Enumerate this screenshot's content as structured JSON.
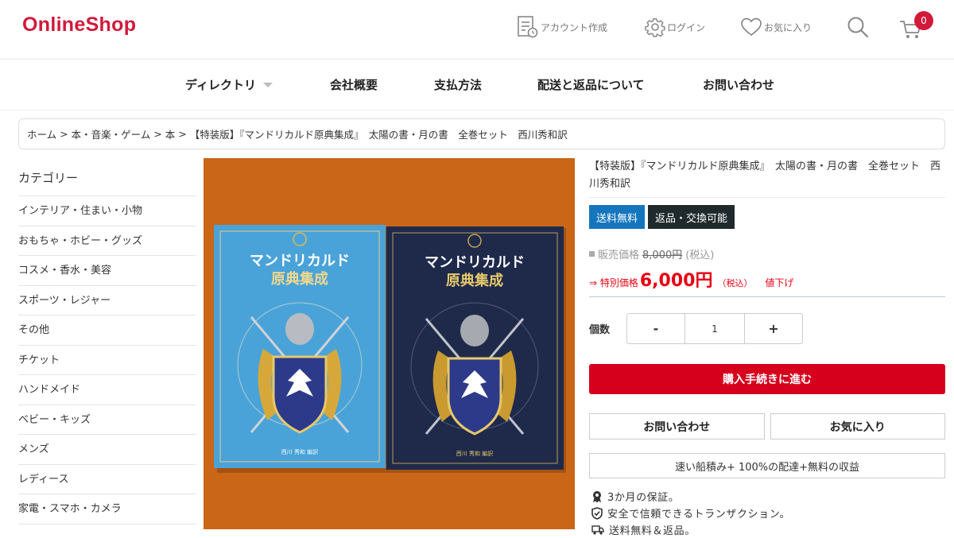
{
  "header": {
    "logo": "OnlineShop",
    "account_label": "アカウント作成",
    "login_label": "ログイン",
    "favorites_label": "お気に入り",
    "cart_count": "0",
    "brand_color": "#d11a3a"
  },
  "nav": {
    "items": [
      "ディレクトリ",
      "会社概要",
      "支払方法",
      "配送と返品について",
      "お問い合わせ"
    ]
  },
  "breadcrumb": {
    "items": [
      "ホーム",
      "本・音楽・ゲーム",
      "本",
      "【特装版】『マンドリカルド原典集成』　太陽の書・月の書　全巻セット　西川秀和訳"
    ],
    "separator": ">"
  },
  "sidebar": {
    "title": "カテゴリー",
    "items": [
      "インテリア・住まい・小物",
      "おもちゃ・ホビー・グッズ",
      "コスメ・香水・美容",
      "スポーツ・レジャー",
      "その他",
      "チケット",
      "ハンドメイド",
      "ベビー・キッズ",
      "メンズ",
      "レディース",
      "家電・スマホ・カメラ"
    ]
  },
  "product": {
    "title": "【特装版】『マンドリカルド原典集成』　太陽の書・月の書　全巻セット　西川秀和訳",
    "tag_free_shipping": "送料無料",
    "tag_returns": "返品・交換可能",
    "regular_label": "販売価格",
    "regular_price": "8,000円",
    "regular_tax": "(税込)",
    "sale_label": "⇒ 特別価格",
    "sale_price": "6,000円",
    "sale_tax": "（税込）",
    "price_down": "値下げ",
    "qty_label": "個数",
    "qty_minus": "-",
    "qty_value": "1",
    "qty_plus": "+",
    "buy_label": "購入手続きに進む",
    "contact_label": "お問い合わせ",
    "favorite_label": "お気に入り",
    "shipping_banner": "速い船積み+ 100%の配達+無料の収益",
    "features": [
      "3か月の保証。",
      "安全で信頼できるトランザクション。",
      "送料無料＆返品。"
    ],
    "book_title_line1": "マンドリカルド",
    "book_title_line2": "原典集成",
    "book_author": "西川 秀和 編訳",
    "book_blue_color": "#4aa3d8",
    "book_navy_color": "#1f2a4a",
    "background_color": "#cf6a1a"
  }
}
